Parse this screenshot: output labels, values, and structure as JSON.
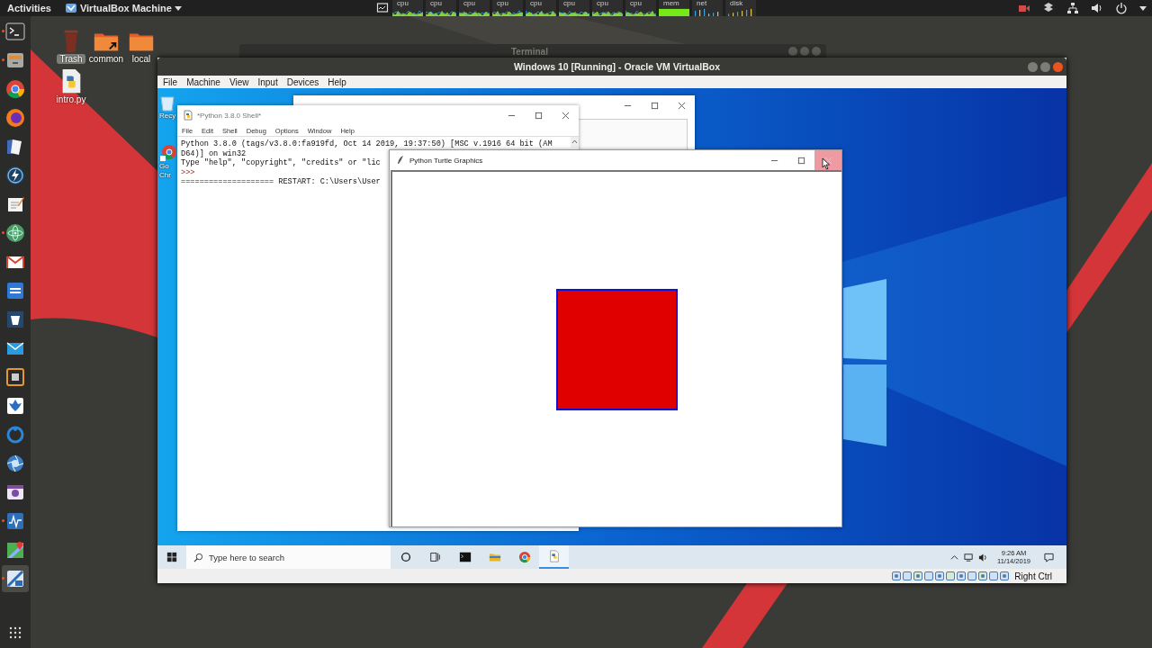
{
  "top_bar": {
    "activities": "Activities",
    "app_menu": "VirtualBox Machine",
    "monitors": [
      {
        "label": "cpu",
        "kind": "graph"
      },
      {
        "label": "cpu",
        "kind": "graph"
      },
      {
        "label": "cpu",
        "kind": "graph"
      },
      {
        "label": "cpu",
        "kind": "graph"
      },
      {
        "label": "cpu",
        "kind": "graph"
      },
      {
        "label": "cpu",
        "kind": "graph"
      },
      {
        "label": "cpu",
        "kind": "graph"
      },
      {
        "label": "cpu",
        "kind": "graph"
      },
      {
        "label": "mem",
        "kind": "bar"
      },
      {
        "label": "net",
        "kind": "spikes"
      },
      {
        "label": "disk",
        "kind": "spikes"
      }
    ]
  },
  "dock": {
    "items": [
      {
        "kind": "terminal",
        "running": true,
        "selected": false
      },
      {
        "kind": "files",
        "running": true,
        "selected": false
      },
      {
        "kind": "chrome",
        "running": false,
        "selected": false
      },
      {
        "kind": "firefox",
        "running": false,
        "selected": false
      },
      {
        "kind": "writer",
        "running": false,
        "selected": false
      },
      {
        "kind": "bolt",
        "running": false,
        "selected": false
      },
      {
        "kind": "editor",
        "running": false,
        "selected": false
      },
      {
        "kind": "atom",
        "running": true,
        "selected": false
      },
      {
        "kind": "gmail",
        "running": false,
        "selected": false
      },
      {
        "kind": "calendar",
        "running": false,
        "selected": false
      },
      {
        "kind": "bucket",
        "running": false,
        "selected": false
      },
      {
        "kind": "mail",
        "running": false,
        "selected": false
      },
      {
        "kind": "board",
        "running": false,
        "selected": false
      },
      {
        "kind": "leaf",
        "running": false,
        "selected": false
      },
      {
        "kind": "ring",
        "running": false,
        "selected": false
      },
      {
        "kind": "aperture",
        "running": false,
        "selected": false
      },
      {
        "kind": "camera",
        "running": false,
        "selected": false
      },
      {
        "kind": "monitor",
        "running": true,
        "selected": false
      },
      {
        "kind": "maps",
        "running": false,
        "selected": false
      },
      {
        "kind": "vbox",
        "running": true,
        "selected": true
      }
    ]
  },
  "desktop_icons": [
    {
      "kind": "trash",
      "label": "Trash",
      "selected": true
    },
    {
      "kind": "folder-link",
      "label": "common",
      "selected": false
    },
    {
      "kind": "folder",
      "label": "local",
      "selected": false
    },
    {
      "kind": "python-file",
      "label": "intro.py",
      "selected": false
    }
  ],
  "terminal_window": {
    "title": "Terminal"
  },
  "vbox_window": {
    "title": "Windows 10 [Running] - Oracle VM VirtualBox",
    "menu": [
      "File",
      "Machine",
      "View",
      "Input",
      "Devices",
      "Help"
    ],
    "host_key": "Right Ctrl"
  },
  "guest": {
    "desktop_icons": [
      {
        "kind": "recycle-bin",
        "lines": [
          "Recy"
        ]
      },
      {
        "kind": "chrome",
        "lines": [
          "Go",
          "Chr"
        ]
      }
    ],
    "shell": {
      "title": "*Python 3.8.0 Shell*",
      "menu": [
        "File",
        "Edit",
        "Shell",
        "Debug",
        "Options",
        "Window",
        "Help"
      ],
      "lines": [
        {
          "kind": "output",
          "text": "Python 3.8.0 (tags/v3.8.0:fa919fd, Oct 14 2019, 19:37:50) [MSC v.1916 64 bit (AM"
        },
        {
          "kind": "output",
          "text": "D64)] on win32"
        },
        {
          "kind": "output",
          "text": "Type \"help\", \"copyright\", \"credits\" or \"lic"
        },
        {
          "kind": "prompt",
          "text": ">>>"
        },
        {
          "kind": "output",
          "text": "==================== RESTART: C:\\Users\\User"
        }
      ]
    },
    "turtle": {
      "title": "Python Turtle Graphics",
      "close_hovered": true
    },
    "taskbar": {
      "search_placeholder": "Type here to search",
      "apps": [
        {
          "kind": "cortana",
          "selected": false
        },
        {
          "kind": "task-view",
          "selected": false
        },
        {
          "kind": "cmd",
          "selected": false
        },
        {
          "kind": "explorer",
          "selected": false
        },
        {
          "kind": "chrome",
          "selected": false
        },
        {
          "kind": "python",
          "selected": true
        }
      ],
      "time": "9:26 AM",
      "date": "11/14/2019"
    }
  }
}
